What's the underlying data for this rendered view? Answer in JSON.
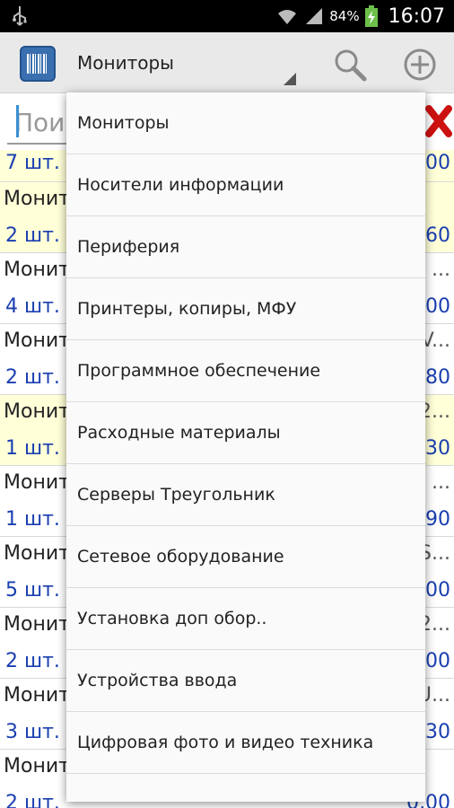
{
  "status_bar": {
    "battery": "84%",
    "time": "16:07",
    "icons": [
      "usb-icon",
      "wifi-icon",
      "signal-icon",
      "battery-charging-icon"
    ]
  },
  "action_bar": {
    "category": "Мониторы",
    "icons": [
      "barcode-icon",
      "search-icon",
      "add-icon"
    ]
  },
  "search": {
    "placeholder": "Пои"
  },
  "list": [
    {
      "name": "",
      "qty": "7 шт.",
      "right": "",
      "price": "00",
      "highlight": true
    },
    {
      "name": "Монит",
      "qty": "2 шт.",
      "right": "",
      "price": "60",
      "highlight": true
    },
    {
      "name": "Монит",
      "qty": "4 шт.",
      "right": "...",
      "price": "00",
      "highlight": false
    },
    {
      "name": "Монит",
      "qty": "2 шт.",
      "right": "V...",
      "price": "80",
      "highlight": false
    },
    {
      "name": "Монит",
      "qty": "1 шт.",
      "right": "2...",
      "price": "30",
      "highlight": true
    },
    {
      "name": "Монит",
      "qty": "1 шт.",
      "right": "...",
      "price": "90",
      "highlight": false
    },
    {
      "name": "Монит",
      "qty": "5 шт.",
      "right": "S...",
      "price": "00",
      "highlight": false
    },
    {
      "name": "Монит",
      "qty": "2 шт.",
      "right": "2...",
      "price": "00",
      "highlight": false
    },
    {
      "name": "Монит",
      "qty": "3 шт.",
      "right": "U...",
      "price": "30",
      "highlight": false
    },
    {
      "name": "Монит",
      "qty": "2 шт.",
      "right": "",
      "price": "0,00",
      "highlight": false
    }
  ],
  "dropdown": {
    "items": [
      "Мониторы",
      "Носители информации",
      "Периферия",
      "Принтеры, копиры, МФУ",
      "Программное обеспечение",
      "Расходные материалы",
      "Серверы Треугольник",
      "Сетевое оборудование",
      "Установка доп обор..",
      "Устройства ввода",
      "Цифровая фото и видео техника"
    ]
  },
  "colors": {
    "highlight_row": "#ffffd8",
    "qty_price": "#1a3fb0",
    "clear_x": "#cc1111",
    "battery": "#6cc04a"
  }
}
